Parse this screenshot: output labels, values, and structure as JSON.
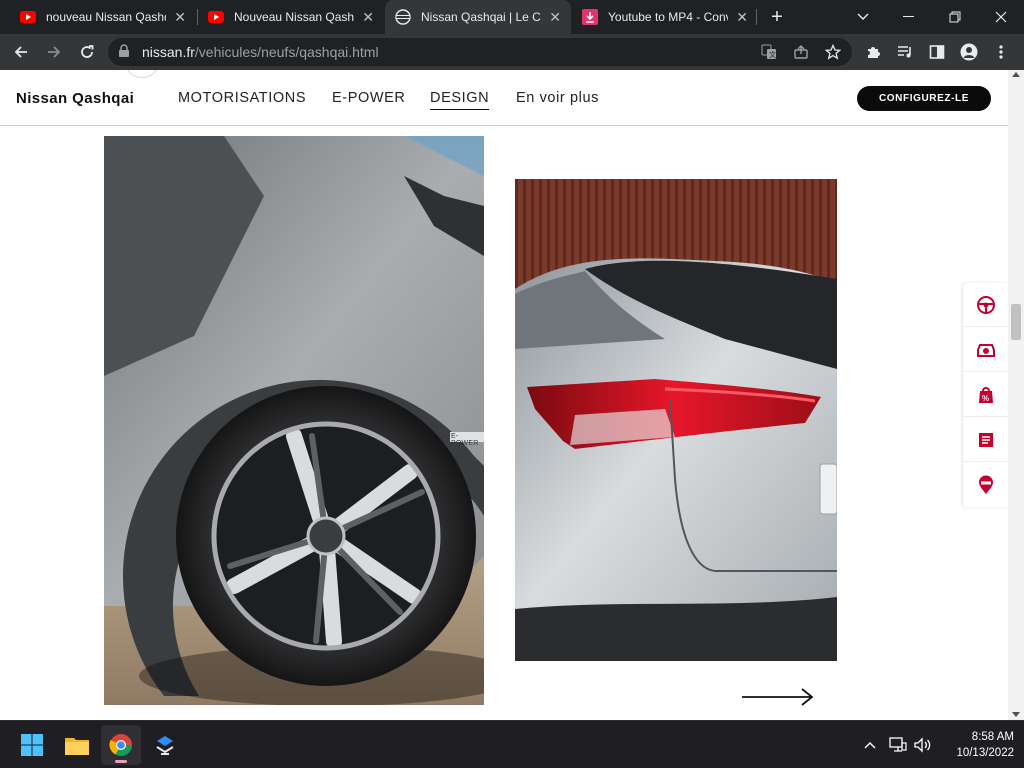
{
  "browser": {
    "tabs": [
      {
        "title": "nouveau Nissan Qashq",
        "favicon": "youtube-icon"
      },
      {
        "title": "Nouveau Nissan Qashq",
        "favicon": "youtube-icon"
      },
      {
        "title": "Nissan Qashqai | Le Cr",
        "favicon": "nissan-icon",
        "active": true
      },
      {
        "title": "Youtube to MP4 - Conv",
        "favicon": "download-icon"
      }
    ],
    "url_host": "nissan.fr",
    "url_path": "/vehicules/neufs/qashqai.html"
  },
  "site": {
    "brand": "Nissan Qashqai",
    "nav": [
      "MOTORISATIONS",
      "E-POWER",
      "DESIGN",
      "En voir plus"
    ],
    "active_nav": "DESIGN",
    "cta": "CONFIGUREZ-LE",
    "badge": "E-POWER"
  },
  "sidetools": [
    "steering-wheel-icon",
    "car-test-icon",
    "promo-tag-icon",
    "brochure-icon",
    "location-pin-icon"
  ],
  "taskbar": {
    "apps": [
      "windows-start-icon",
      "file-explorer-icon",
      "chrome-icon",
      "app-icon"
    ],
    "time": "8:58 AM",
    "date": "10/13/2022"
  },
  "colors": {
    "accent": "#c3002f",
    "chrome_dark": "#202124",
    "chrome_toolbar": "#35363a"
  }
}
